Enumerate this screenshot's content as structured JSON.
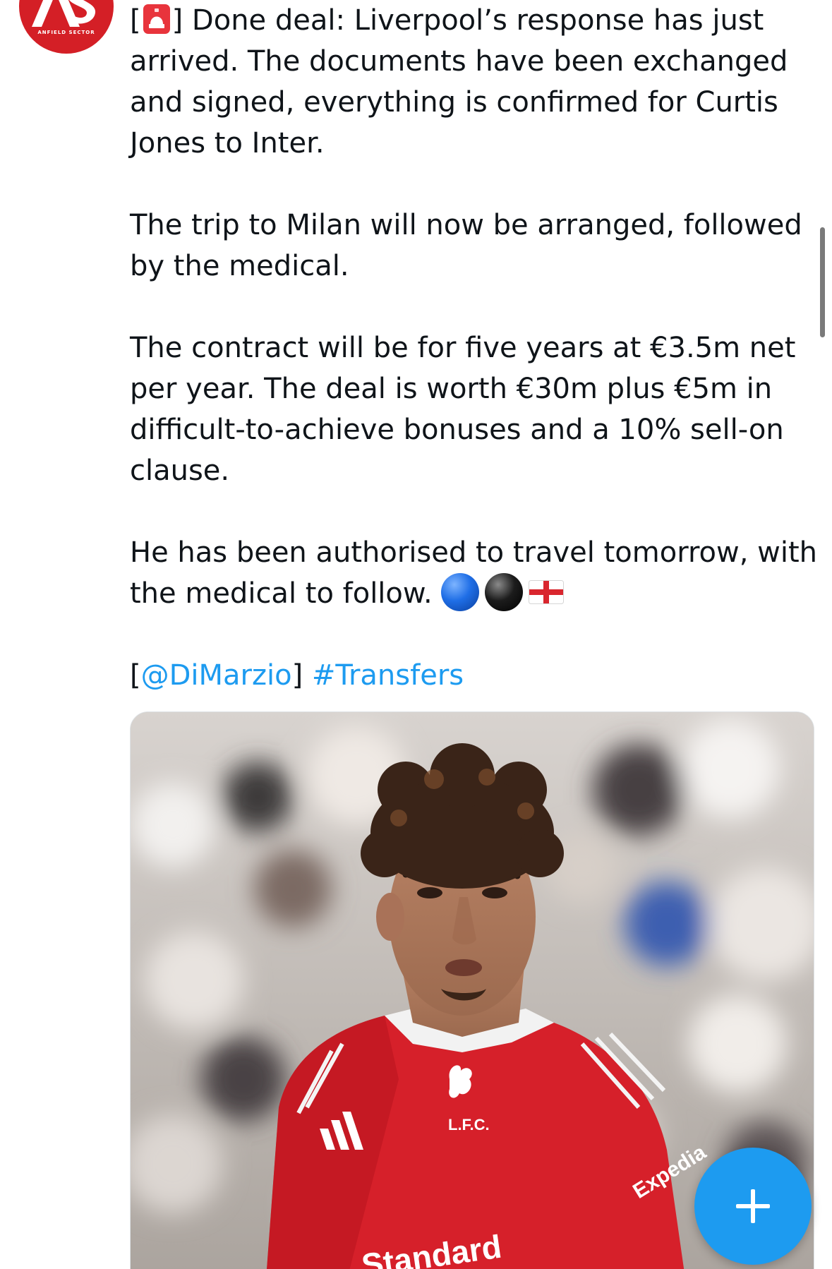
{
  "account": {
    "avatar_text": "AS",
    "avatar_caption": "ANFIELD SECTOR"
  },
  "tweet": {
    "paragraphs": [
      {
        "lines": [
          {
            "prefix": "[",
            "emoji": "police-car-light",
            "suffix": "] Done deal: Liverpool’s response has just"
          },
          {
            "text": "arrived. The documents have been exchanged"
          },
          {
            "text": "and signed, everything is confirmed for Curtis"
          },
          {
            "text": "Jones to Inter."
          }
        ]
      },
      {
        "lines": [
          {
            "text": "The trip to Milan will now be arranged, followed"
          },
          {
            "text": "by the medical."
          }
        ]
      },
      {
        "lines": [
          {
            "text": "The contract will be for five years at €3.5m net"
          },
          {
            "text": "per year. The deal is worth €30m plus €5m in"
          },
          {
            "text": "difficult-to-achieve bonuses and a 10% sell-on"
          },
          {
            "text": "clause."
          }
        ]
      },
      {
        "lines": [
          {
            "text": "He has been authorised to travel tomorrow, with"
          },
          {
            "text": "the medical to follow.",
            "emojis": [
              "blue-circle",
              "black-circle",
              "england-flag"
            ]
          }
        ]
      }
    ],
    "source": {
      "open_bracket": "[",
      "mention": "@DiMarzio",
      "close_bracket": "]",
      "hashtag": "#Transfers"
    }
  },
  "media": {
    "kit_crest_text": "L.F.C.",
    "sponsor_text": "Standard",
    "sleeve_text": "Expedia"
  },
  "colors": {
    "link": "#1d9bf0",
    "brand_red": "#d41f26",
    "fab": "#1d9bf0",
    "text": "#0f1419"
  },
  "fab": {
    "icon": "plus-icon"
  }
}
